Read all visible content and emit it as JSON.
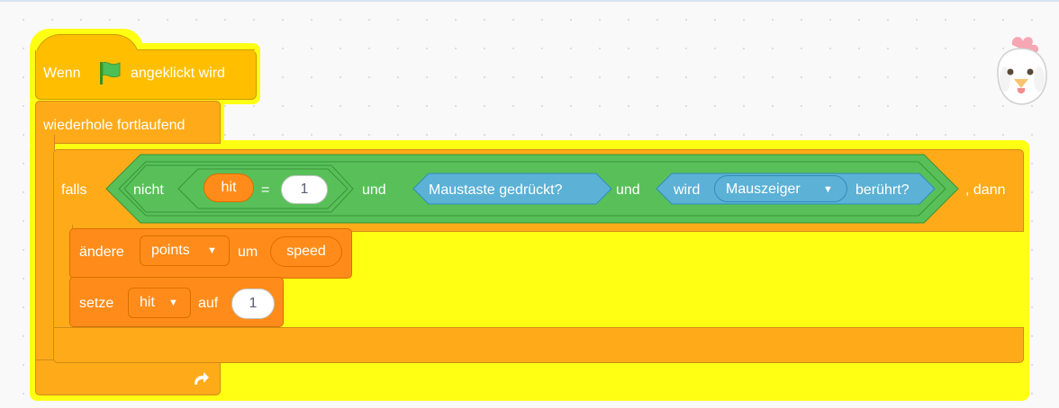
{
  "event_block": {
    "label_before": "Wenn",
    "flag_icon": "green-flag-icon",
    "label_after": "angeklickt wird"
  },
  "forever_block": {
    "label": "wiederhole fortlaufend",
    "loop_icon": "loop-arrow-icon"
  },
  "if_block": {
    "label_if": "falls",
    "label_then": ", dann",
    "condition": {
      "and1_label": "und",
      "and2_label": "und",
      "not_label": "nicht",
      "equals": {
        "left_var": "hit",
        "operator": "=",
        "right_value": "1"
      },
      "mouse_down_label": "Maustaste gedrückt?",
      "touching": {
        "label_before": "wird",
        "menu_value": "Mauszeiger",
        "label_after": "berührt?"
      }
    }
  },
  "change_block": {
    "label": "ändere",
    "variable": "points",
    "by_label": "um",
    "value": "speed"
  },
  "set_block": {
    "label": "setze",
    "variable": "hit",
    "to_label": "auf",
    "value": "1"
  },
  "sprite_icon": "chicken-sprite-icon",
  "colors": {
    "events": "#ffbf00",
    "control": "#ffab19",
    "operators": "#59c059",
    "sensing": "#5cb1d6",
    "variables": "#ff8c1a",
    "glow": "#ffff14"
  }
}
